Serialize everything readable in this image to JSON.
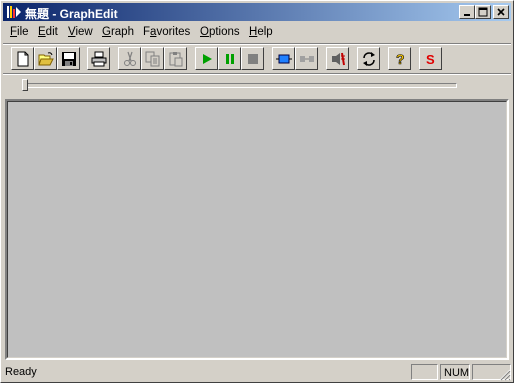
{
  "window": {
    "title": "無題 - GraphEdit"
  },
  "menu": [
    {
      "label": "File",
      "key": "F"
    },
    {
      "label": "Edit",
      "key": "E"
    },
    {
      "label": "View",
      "key": "V"
    },
    {
      "label": "Graph",
      "key": "G"
    },
    {
      "label": "Favorites",
      "key": "a"
    },
    {
      "label": "Options",
      "key": "O"
    },
    {
      "label": "Help",
      "key": "H"
    }
  ],
  "toolbar": {
    "buttons": [
      {
        "icon": "new-document-icon",
        "enabled": true
      },
      {
        "icon": "open-folder-icon",
        "enabled": true
      },
      {
        "icon": "save-icon",
        "enabled": true
      },
      {
        "icon": "print-icon",
        "enabled": true
      },
      {
        "icon": "cut-icon",
        "enabled": false
      },
      {
        "icon": "copy-icon",
        "enabled": false
      },
      {
        "icon": "paste-icon",
        "enabled": false
      },
      {
        "icon": "play-icon",
        "enabled": true
      },
      {
        "icon": "pause-icon",
        "enabled": true
      },
      {
        "icon": "stop-icon",
        "enabled": false
      },
      {
        "icon": "frame-step-icon",
        "enabled": true
      },
      {
        "icon": "disconnect-icon",
        "enabled": false
      },
      {
        "icon": "clock-sync-icon",
        "enabled": true
      },
      {
        "icon": "refresh-icon",
        "enabled": true
      },
      {
        "icon": "help-icon",
        "enabled": true
      },
      {
        "icon": "seek-icon",
        "enabled": true
      }
    ],
    "seek_label": "S",
    "help_label": "?"
  },
  "seekbar": {
    "position": 0
  },
  "status": {
    "text": "Ready",
    "num_indicator": "NUM"
  },
  "colors": {
    "title_start": "#0a246a",
    "title_end": "#a6caf0",
    "face": "#d4d0c8",
    "canvas": "#c0c0c0"
  }
}
